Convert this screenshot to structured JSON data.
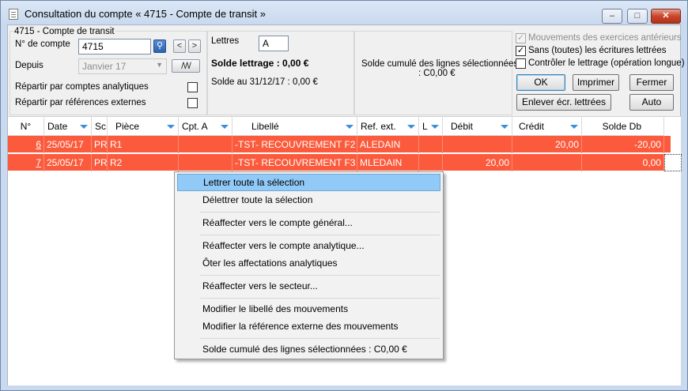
{
  "window": {
    "title": "Consultation du compte « 4715 - Compte de transit »"
  },
  "titlebar_buttons": {
    "minimize": "–",
    "maximize": "□",
    "close": "✕"
  },
  "account": {
    "group_label": "4715 - Compte de transit",
    "account_label": "N° de compte",
    "account_value": "4715",
    "since_label": "Depuis",
    "since_value": "Janvier 17",
    "analytic_label": "Répartir par comptes analytiques",
    "external_label": "Répartir par références externes",
    "nav_prev": "<",
    "nav_next": ">"
  },
  "lettering": {
    "letters_label": "Lettres",
    "letters_value": "A",
    "balance_label": "Solde lettrage : 0,00 €",
    "balance_date": "Solde au 31/12/17 : 0,00 €"
  },
  "selection": {
    "line1": "Solde cumulé des lignes sélectionnées",
    "line2": ": C0,00 €"
  },
  "options": {
    "prev_years": "Mouvements des exercices antérieurs",
    "no_lettered": "Sans (toutes) les écritures lettrées",
    "check_lettering": "Contrôler le lettrage (opération longue)"
  },
  "buttons": {
    "ok": "OK",
    "print": "Imprimer",
    "close": "Fermer",
    "remove_lettered": "Enlever écr. lettrées",
    "auto": "Auto"
  },
  "columns": [
    "N°",
    "Date",
    "Sc",
    "Pièce",
    "Cpt. A",
    "Libellé",
    "Ref. ext.",
    "L",
    "Débit",
    "Crédit",
    "Solde Db"
  ],
  "rows": [
    {
      "num": "6",
      "date": "25/05/17",
      "sc": "PR",
      "piece": "R1",
      "cpta": "",
      "libelle": "-TST- RECOUVREMENT F2",
      "ref": "ALEDAIN",
      "l": "",
      "debit": "",
      "credit": "20,00",
      "solde": "-20,00"
    },
    {
      "num": "7",
      "date": "25/05/17",
      "sc": "PR",
      "piece": "R2",
      "cpta": "",
      "libelle": "-TST- RECOUVREMENT F3",
      "ref": "MLEDAIN",
      "l": "",
      "debit": "20,00",
      "credit": "",
      "solde": "0,00"
    }
  ],
  "context_menu": [
    "Lettrer toute la sélection",
    "Délettrer toute la sélection",
    "Réaffecter vers le compte général...",
    "Réaffecter vers le compte analytique...",
    "Ôter les affectations analytiques",
    "Réaffecter vers le secteur...",
    "Modifier le libellé des mouvements",
    "Modifier la référence externe des mouvements",
    "Solde cumulé des lignes sélectionnées : C0,00 €"
  ],
  "colors": {
    "row_highlight": "#fb5a3c",
    "menu_highlight": "#91c9f7",
    "filter_arrow": "#3c8fd6"
  }
}
